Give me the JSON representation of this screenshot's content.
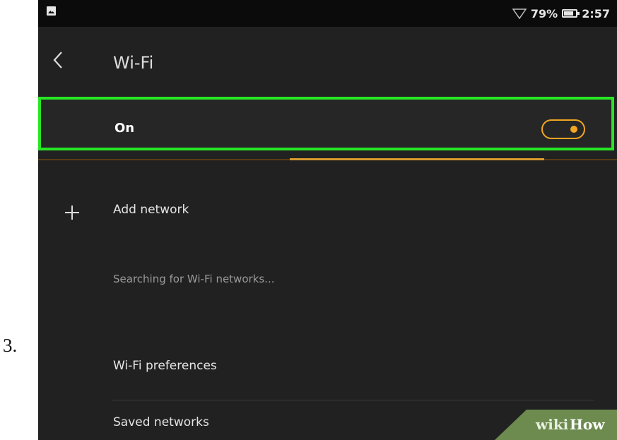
{
  "step": {
    "number": "3."
  },
  "status_bar": {
    "battery_percent": "79%",
    "time": "2:57"
  },
  "header": {
    "title": "Wi-Fi"
  },
  "toggle": {
    "label": "On",
    "state": "on",
    "accent_color": "#f1a623",
    "highlight_color": "#27e624"
  },
  "scan_progress": 0.44,
  "list": {
    "add_network": "Add network",
    "status": "Searching for Wi-Fi networks...",
    "preferences": "Wi-Fi preferences",
    "saved_networks": "Saved networks"
  },
  "watermark": {
    "wiki": "wiki",
    "how": "How"
  }
}
